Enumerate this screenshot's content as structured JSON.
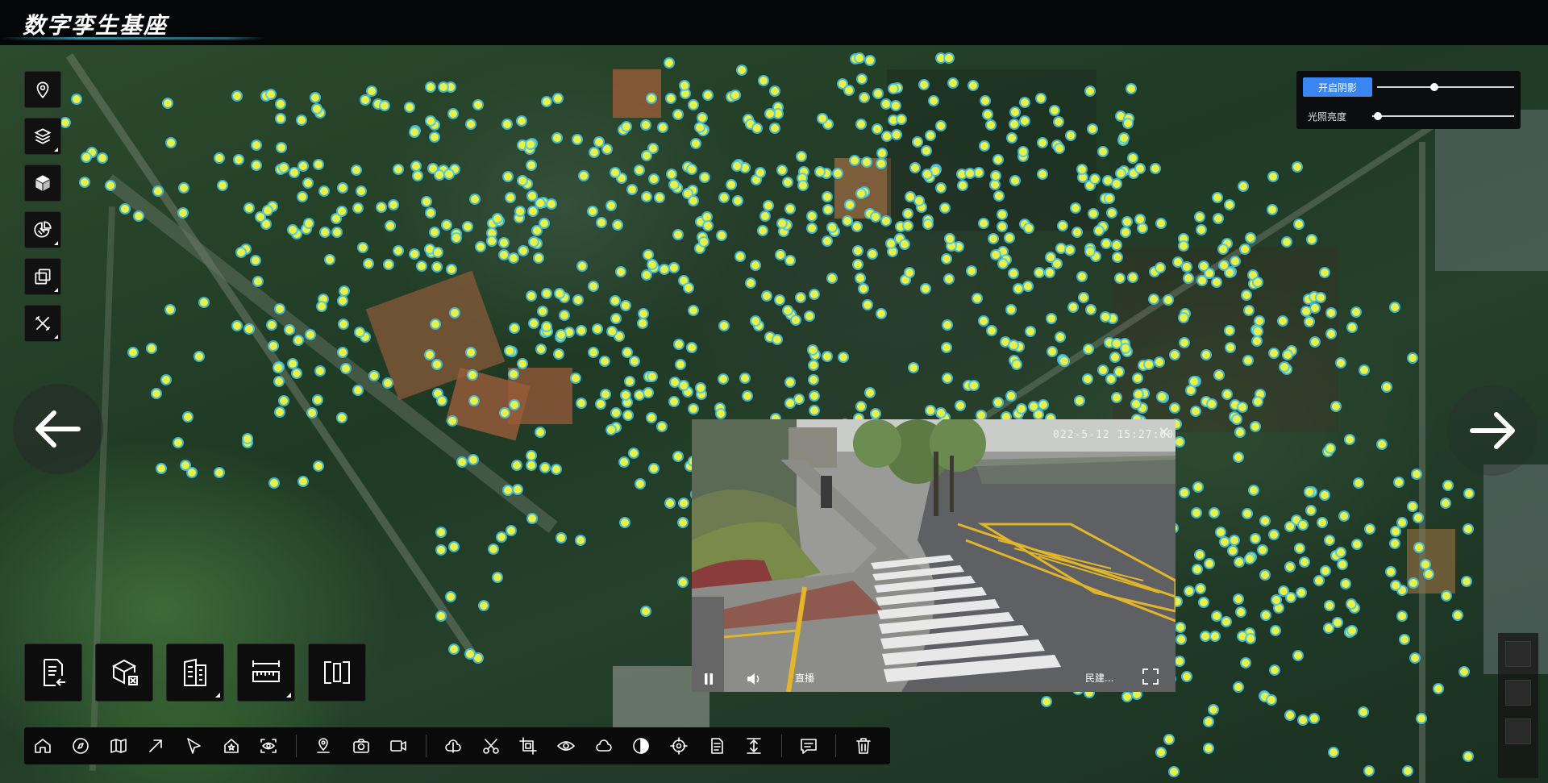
{
  "app": {
    "title": "数字孪生基座"
  },
  "light_panel": {
    "shadow_button_label": "开启阴影",
    "light_label": "光照亮度",
    "shadow_slider_value": 0.42,
    "light_slider_value": 0.0
  },
  "left_tools": [
    {
      "name": "location-pin-icon"
    },
    {
      "name": "layers-icon"
    },
    {
      "name": "cube-icon"
    },
    {
      "name": "pie-chart-icon"
    },
    {
      "name": "copy-icon"
    },
    {
      "name": "tools-icon"
    }
  ],
  "big_tools": [
    {
      "name": "document-import-icon"
    },
    {
      "name": "box-remove-icon"
    },
    {
      "name": "building-icon"
    },
    {
      "name": "ruler-icon"
    },
    {
      "name": "split-view-icon"
    }
  ],
  "bottom_tools": [
    {
      "name": "home-icon"
    },
    {
      "name": "compass-icon"
    },
    {
      "name": "map-icon"
    },
    {
      "name": "arrow-up-right-icon"
    },
    {
      "name": "cursor-icon"
    },
    {
      "name": "house-star-icon"
    },
    {
      "name": "target-eye-icon"
    },
    {
      "name": "separator"
    },
    {
      "name": "map-pin-icon"
    },
    {
      "name": "camera-icon"
    },
    {
      "name": "video-camera-icon"
    },
    {
      "name": "separator"
    },
    {
      "name": "cloud-cut-icon"
    },
    {
      "name": "scissors-icon"
    },
    {
      "name": "crop-icon"
    },
    {
      "name": "eye-icon"
    },
    {
      "name": "cloud-icon"
    },
    {
      "name": "contrast-icon"
    },
    {
      "name": "crosshair-icon"
    },
    {
      "name": "document-icon"
    },
    {
      "name": "expand-vertical-icon"
    },
    {
      "name": "separator"
    },
    {
      "name": "comment-icon"
    },
    {
      "name": "separator"
    },
    {
      "name": "trash-icon"
    }
  ],
  "video": {
    "timestamp": "022-5-12 15:27:00",
    "live_label": "直播",
    "stream_label": "民建..."
  }
}
